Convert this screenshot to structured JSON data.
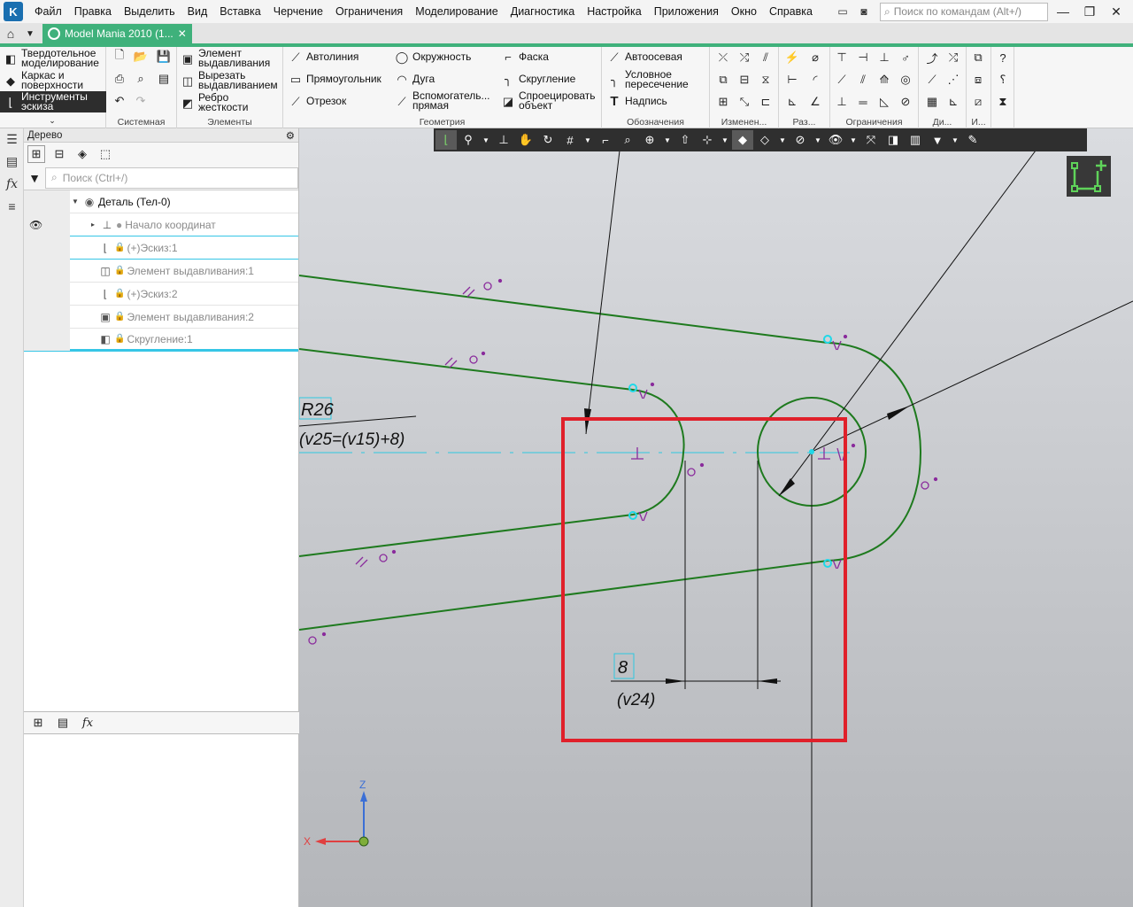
{
  "menu": {
    "items": [
      "Файл",
      "Правка",
      "Выделить",
      "Вид",
      "Вставка",
      "Черчение",
      "Ограничения",
      "Моделирование",
      "Диагностика",
      "Настройка",
      "Приложения",
      "Окно",
      "Справка"
    ],
    "search_placeholder": "Поиск по командам (Alt+/)"
  },
  "tabs": {
    "document_title": "Model Mania 2010 (1...",
    "close": "✕"
  },
  "ribbon": {
    "modes": [
      "Твердотельное моделирование",
      "Каркас и поверхности",
      "Инструменты эскиза"
    ],
    "groups": {
      "system": "Системная",
      "elements": "Элементы",
      "geometry": "Геометрия",
      "designations": "Обозначения",
      "modify": "Изменен...",
      "dims": "Раз...",
      "constraints": "Ограничения",
      "di": "Ди...",
      "i": "И..."
    },
    "elements": [
      "Элемент выдавливания",
      "Вырезать выдавливанием",
      "Ребро жесткости"
    ],
    "geometry": [
      "Автолиния",
      "Окружность",
      "Фаска",
      "Прямоугольник",
      "Дуга",
      "Скругление",
      "Отрезок",
      "Вспомогатель... прямая",
      "Спроецировать объект"
    ],
    "designations": [
      "Автоосевая",
      "Условное пересечение",
      "Надпись"
    ]
  },
  "tree": {
    "title": "Дерево",
    "search_placeholder": "Поиск (Ctrl+/)",
    "items": [
      {
        "label": "Деталь (Тел-0)"
      },
      {
        "label": "Начало координат"
      },
      {
        "label": "(+)Эскиз:1"
      },
      {
        "label": "Элемент выдавливания:1"
      },
      {
        "label": "(+)Эскиз:2"
      },
      {
        "label": "Элемент выдавливания:2"
      },
      {
        "label": "Скругление:1"
      }
    ]
  },
  "canvas": {
    "dim_radius": "R26",
    "dim_radius_expr": "(v25=(v15)+8)",
    "dim_linear": "8",
    "dim_linear_var": "(v24)",
    "axis_z": "Z",
    "axis_x": "X",
    "highlight_color": "#e0202a",
    "sketch_color": "#1e7a1e"
  }
}
